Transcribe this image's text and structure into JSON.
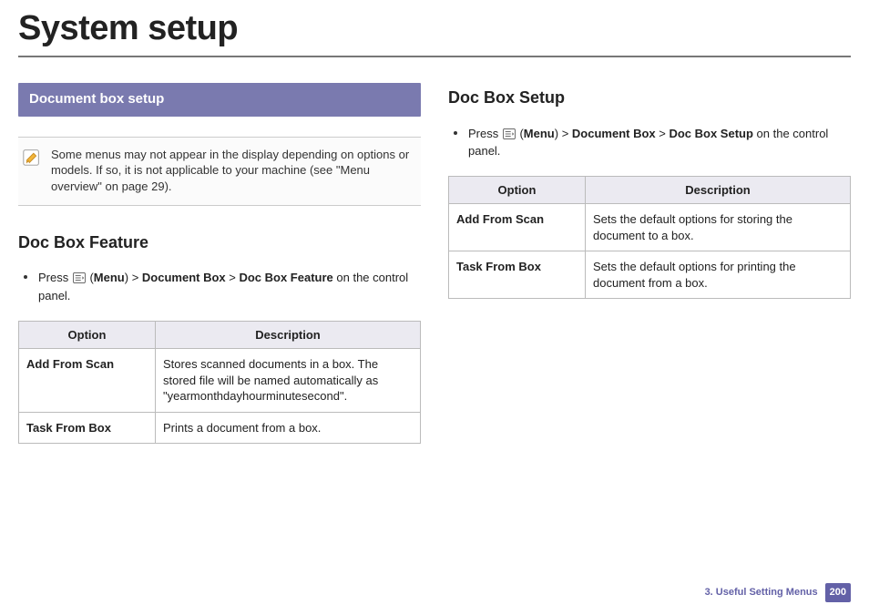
{
  "page_title": "System setup",
  "left": {
    "section_bar": "Document box setup",
    "note": "Some menus may not appear in the display depending on options or models. If so, it is not applicable to your machine (see \"Menu overview\" on page 29).",
    "subhead": "Doc Box Feature",
    "nav": {
      "prefix": "Press ",
      "after_icon": " (",
      "menu": "Menu",
      "after_menu": ") > ",
      "seg1": "Document Box",
      "gt": " > ",
      "seg2": "Doc Box Feature",
      "tail": " on the control panel."
    },
    "table": {
      "h_option": "Option",
      "h_desc": "Description",
      "rows": [
        {
          "option": "Add From Scan",
          "desc": "Stores scanned documents in a box. The stored file will be named automatically as \"yearmonthdayhourminutesecond\"."
        },
        {
          "option": "Task From Box",
          "desc": "Prints a document from a box."
        }
      ]
    }
  },
  "right": {
    "subhead": "Doc Box Setup",
    "nav": {
      "prefix": "Press ",
      "after_icon": " (",
      "menu": "Menu",
      "after_menu": ") > ",
      "seg1": "Document Box",
      "gt": " > ",
      "seg2": "Doc Box Setup",
      "tail": " on the control panel."
    },
    "table": {
      "h_option": "Option",
      "h_desc": "Description",
      "rows": [
        {
          "option": "Add From Scan",
          "desc": "Sets the default options for storing the document to a box."
        },
        {
          "option": "Task From Box",
          "desc": "Sets the default options for printing the document from a box."
        }
      ]
    }
  },
  "footer": {
    "chapter": "3.  Useful Setting Menus",
    "page": "200"
  }
}
